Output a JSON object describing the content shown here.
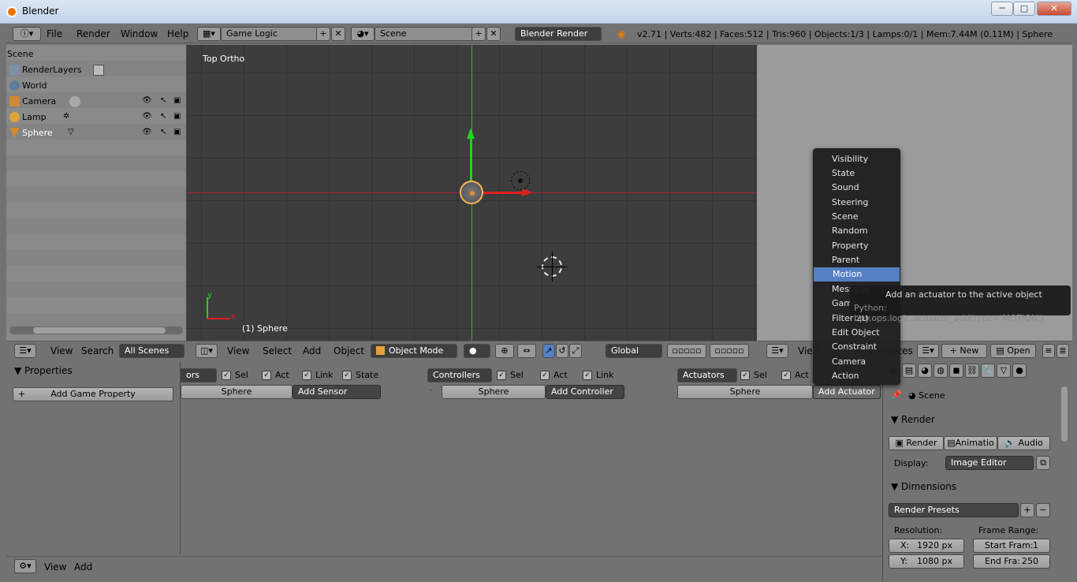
{
  "window": {
    "title": "Blender",
    "buttons": [
      "─",
      "□",
      "✕"
    ]
  },
  "topbar": {
    "menus": [
      "File",
      "Render",
      "Window",
      "Help"
    ],
    "screen_layout": "Game Logic",
    "scene": "Scene",
    "render_engine": "Blender Render",
    "stats": "v2.71 | Verts:482 | Faces:512 | Tris:960 | Objects:1/3 | Lamps:0/1 | Mem:7.44M (0.11M) | Sphere"
  },
  "outliner": {
    "items": [
      {
        "label": "Scene"
      },
      {
        "label": "RenderLayers"
      },
      {
        "label": "World"
      },
      {
        "label": "Camera"
      },
      {
        "label": "Lamp"
      },
      {
        "label": "Sphere"
      }
    ],
    "header": {
      "view": "View",
      "search": "Search",
      "filter": "All Scenes"
    }
  },
  "viewport": {
    "view_label": "Top Ortho",
    "object_label": "(1) Sphere",
    "header": {
      "view": "View",
      "select": "Select",
      "add": "Add",
      "object": "Object",
      "mode": "Object Mode",
      "orientation": "Global"
    },
    "axis_y": "y",
    "axis_x": "x"
  },
  "right_header": {
    "view": "View",
    "new": "New",
    "open": "Open",
    "partial": "emplates"
  },
  "left_props": {
    "title": "Properties",
    "add_button": "Add Game Property",
    "footer": {
      "view": "View",
      "add": "Add"
    }
  },
  "logic": {
    "sensors": {
      "dropdown": "ors",
      "sel": "Sel",
      "act": "Act",
      "link": "Link",
      "state": "State",
      "object": "Sphere",
      "add": "Add Sensor"
    },
    "controllers": {
      "dropdown": "Controllers",
      "sel": "Sel",
      "act": "Act",
      "link": "Link",
      "object": "Sphere",
      "add": "Add Controller"
    },
    "actuators": {
      "dropdown": "Actuators",
      "sel": "Sel",
      "act": "Act",
      "object": "Sphere",
      "add": "Add Actuator"
    }
  },
  "dropdown_menu": {
    "items": [
      "Visibility",
      "State",
      "Sound",
      "Steering",
      "Scene",
      "Random",
      "Property",
      "Parent",
      "Motion",
      "Message",
      "Game",
      "Filter 2D",
      "Edit Object",
      "Constraint",
      "Camera",
      "Action"
    ],
    "highlighted": "Motion"
  },
  "tooltip": {
    "text": "Add an actuator to the active object",
    "python": "Python: bpy.ops.logic.actuator_add(type='MOTION')"
  },
  "props_right": {
    "scene_label": "Scene",
    "render_section": "Render",
    "render_btn": "Render",
    "animation_btn": "Animatio",
    "audio_btn": "Audio",
    "display_label": "Display:",
    "display_value": "Image Editor",
    "dimensions_section": "Dimensions",
    "render_presets": "Render Presets",
    "resolution_label": "Resolution:",
    "frame_range_label": "Frame Range:",
    "res_x": "X:",
    "res_x_val": "1920 px",
    "res_y": "Y:",
    "res_y_val": "1080 px",
    "start_label": "Start Fram:",
    "start_val": "1",
    "end_label": "End Fra:",
    "end_val": "250"
  },
  "colors": {
    "accent": "#5680c2",
    "viewport_bg": "#3d3d3d",
    "panel_bg": "#727272",
    "menu_bg": "#202020"
  }
}
